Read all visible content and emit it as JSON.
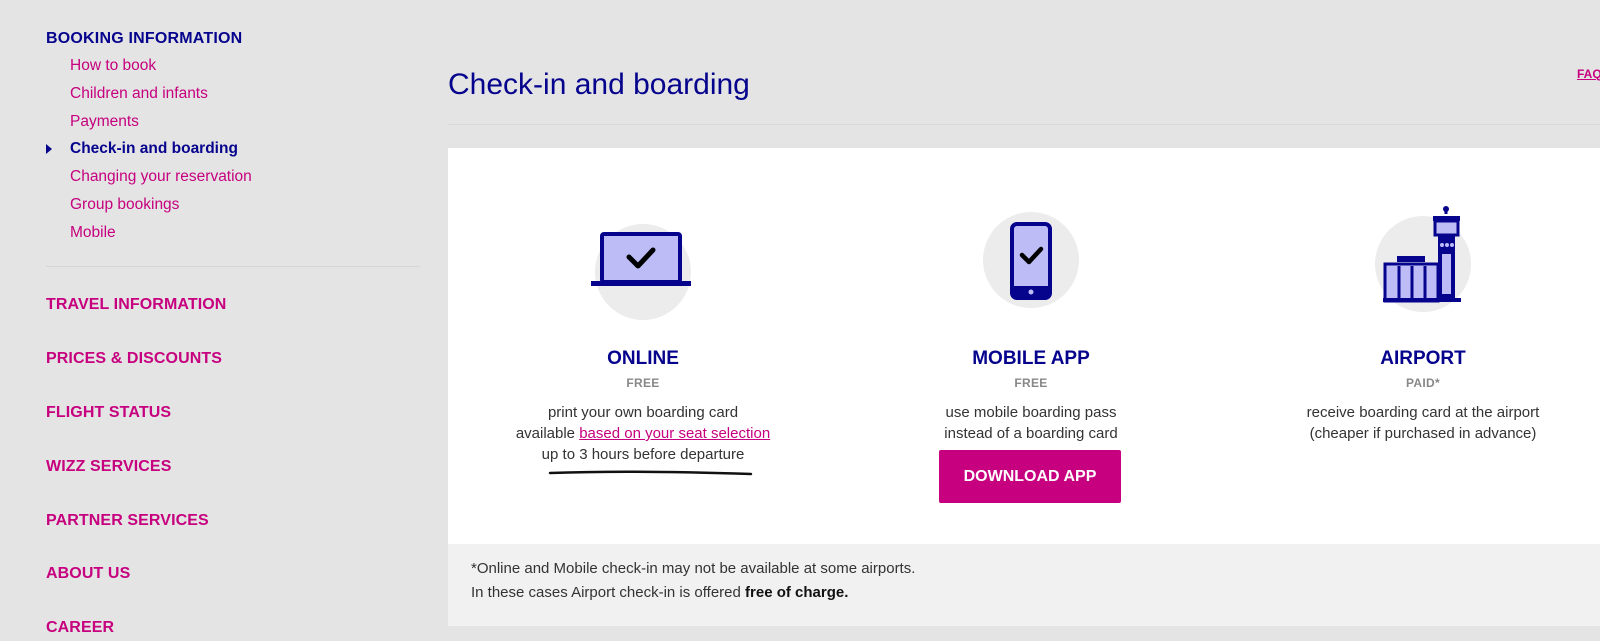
{
  "sidebar": {
    "booking_heading": "BOOKING INFORMATION",
    "booking_items": [
      {
        "label": "How to book"
      },
      {
        "label": "Children and infants"
      },
      {
        "label": "Payments"
      },
      {
        "label": "Check-in and boarding"
      },
      {
        "label": "Changing your reservation"
      },
      {
        "label": "Group bookings"
      },
      {
        "label": "Mobile"
      }
    ],
    "active_index": 3,
    "sections": [
      {
        "label": "TRAVEL INFORMATION"
      },
      {
        "label": "PRICES & DISCOUNTS"
      },
      {
        "label": "FLIGHT STATUS"
      },
      {
        "label": "WIZZ SERVICES"
      },
      {
        "label": "PARTNER SERVICES"
      },
      {
        "label": "ABOUT US"
      },
      {
        "label": "CAREER"
      }
    ]
  },
  "main": {
    "title": "Check-in and boarding",
    "faq_label": "FAQ",
    "options": [
      {
        "icon": "laptop-check-icon",
        "title": "ONLINE",
        "price": "FREE",
        "line1": "print your own boarding card",
        "line2_prefix": "available ",
        "line2_link": "based on your seat selection",
        "line3": "up to 3 hours before departure"
      },
      {
        "icon": "phone-check-icon",
        "title": "MOBILE APP",
        "price": "FREE",
        "line1": "use mobile boarding pass",
        "line2": "instead of a boarding card",
        "button_label": "DOWNLOAD APP"
      },
      {
        "icon": "airport-tower-icon",
        "title": "AIRPORT",
        "price": "PAID*",
        "line1": "receive boarding card at the airport",
        "line2": "(cheaper if purchased in advance)"
      }
    ],
    "footnote": {
      "line1": "*Online and Mobile check-in may not be available at some airports.",
      "line2_prefix": "In these cases Airport check-in is offered ",
      "line2_bold": "free of charge."
    }
  },
  "colors": {
    "brand_magenta": "#c6007e",
    "brand_navy": "#06038d",
    "icon_lavender": "#bdbcf6",
    "page_bg": "#e4e4e4"
  }
}
